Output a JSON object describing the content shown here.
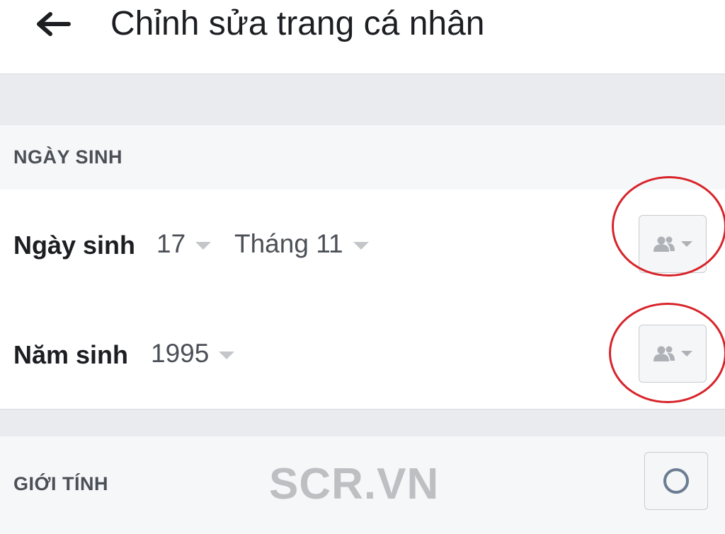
{
  "header": {
    "back_icon": "arrow-left-icon",
    "title": "Chỉnh sửa trang cá nhân"
  },
  "birthday_section": {
    "heading": "NGÀY SINH",
    "birth_date": {
      "label": "Ngày sinh",
      "day": "17",
      "month": "Tháng 11",
      "privacy_icon": "friends-icon"
    },
    "birth_year": {
      "label": "Năm sinh",
      "year": "1995",
      "privacy_icon": "friends-icon"
    }
  },
  "gender_section": {
    "heading": "GIỚI TÍNH",
    "radio_icon": "radio-circle-icon"
  },
  "watermark": "SCR.VN",
  "colors": {
    "annotation_circle": "#d7242a",
    "section_bg": "#e9ebee"
  }
}
